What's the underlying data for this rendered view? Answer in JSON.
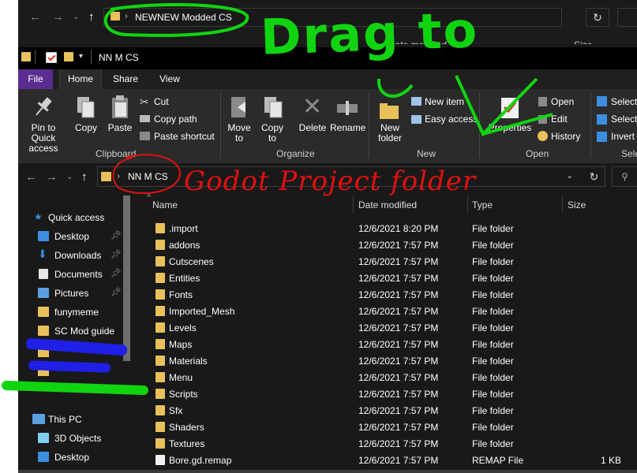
{
  "back_window": {
    "path_text": "NEWNEW Modded CS",
    "col_date": "Date modified",
    "col_size": "Size"
  },
  "title_bar": {
    "title": "NN M CS"
  },
  "ribbon": {
    "tabs": {
      "file": "File",
      "home": "Home",
      "share": "Share",
      "view": "View"
    },
    "clipboard": {
      "pin": "Pin to Quick access",
      "copy": "Copy",
      "paste": "Paste",
      "cut": "Cut",
      "copy_path": "Copy path",
      "paste_shortcut": "Paste shortcut",
      "group": "Clipboard"
    },
    "organize": {
      "move_to": "Move to",
      "copy_to": "Copy to",
      "delete": "Delete",
      "rename": "Rename",
      "group": "Organize"
    },
    "new": {
      "new_folder": "New folder",
      "new_item": "New item",
      "easy_access": "Easy access",
      "group": "New"
    },
    "open": {
      "properties": "Properties",
      "open": "Open",
      "edit": "Edit",
      "history": "History",
      "group": "Open"
    },
    "select": {
      "select_all": "Select",
      "select_none": "Select",
      "invert": "Invert",
      "group": "Sele"
    }
  },
  "address": {
    "path_text": "NN M CS"
  },
  "nav": {
    "quick_access": "Quick access",
    "items": [
      {
        "label": "Desktop",
        "pinned": true
      },
      {
        "label": "Downloads",
        "pinned": true
      },
      {
        "label": "Documents",
        "pinned": true
      },
      {
        "label": "Pictures",
        "pinned": true
      },
      {
        "label": "funymeme",
        "pinned": false
      },
      {
        "label": "SC Mod guide",
        "pinned": false
      }
    ],
    "this_pc": "This PC",
    "pc_items": [
      "3D Objects",
      "Desktop"
    ]
  },
  "columns": {
    "name": "Name",
    "date": "Date modified",
    "type": "Type",
    "size": "Size"
  },
  "files": [
    {
      "name": ".import",
      "date": "12/6/2021 8:20 PM",
      "type": "File folder",
      "size": ""
    },
    {
      "name": "addons",
      "date": "12/6/2021 7:57 PM",
      "type": "File folder",
      "size": ""
    },
    {
      "name": "Cutscenes",
      "date": "12/6/2021 7:57 PM",
      "type": "File folder",
      "size": ""
    },
    {
      "name": "Entities",
      "date": "12/6/2021 7:57 PM",
      "type": "File folder",
      "size": ""
    },
    {
      "name": "Fonts",
      "date": "12/6/2021 7:57 PM",
      "type": "File folder",
      "size": ""
    },
    {
      "name": "Imported_Mesh",
      "date": "12/6/2021 7:57 PM",
      "type": "File folder",
      "size": ""
    },
    {
      "name": "Levels",
      "date": "12/6/2021 7:57 PM",
      "type": "File folder",
      "size": ""
    },
    {
      "name": "Maps",
      "date": "12/6/2021 7:57 PM",
      "type": "File folder",
      "size": ""
    },
    {
      "name": "Materials",
      "date": "12/6/2021 7:57 PM",
      "type": "File folder",
      "size": ""
    },
    {
      "name": "Menu",
      "date": "12/6/2021 7:57 PM",
      "type": "File folder",
      "size": ""
    },
    {
      "name": "Scripts",
      "date": "12/6/2021 7:57 PM",
      "type": "File folder",
      "size": ""
    },
    {
      "name": "Sfx",
      "date": "12/6/2021 7:57 PM",
      "type": "File folder",
      "size": ""
    },
    {
      "name": "Shaders",
      "date": "12/6/2021 7:57 PM",
      "type": "File folder",
      "size": ""
    },
    {
      "name": "Textures",
      "date": "12/6/2021 7:57 PM",
      "type": "File folder",
      "size": ""
    },
    {
      "name": "Bore.gd.remap",
      "date": "12/6/2021 7:57 PM",
      "type": "REMAP File",
      "size": "1 KB"
    }
  ],
  "annotations": {
    "drag_to": "Drag to",
    "godot_note": "Godot Project folder",
    "green": "#11d411",
    "red": "#e01010",
    "blue": "#1f1fe8"
  }
}
